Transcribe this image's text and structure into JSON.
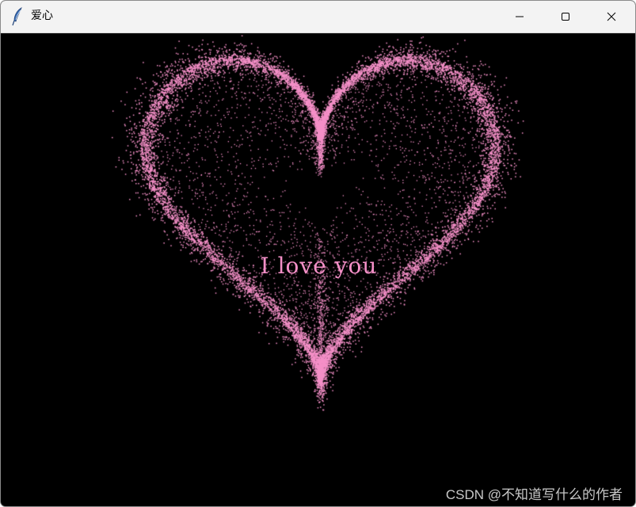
{
  "window": {
    "title": "爱心",
    "icon": "feather-icon",
    "controls": {
      "minimize_icon": "minimize-icon",
      "maximize_icon": "maximize-icon",
      "close_icon": "close-icon"
    }
  },
  "canvas": {
    "background_color": "#000000",
    "heart_color": "#f590c8",
    "text": "I love you"
  },
  "watermark": "CSDN @不知道写什么的作者"
}
